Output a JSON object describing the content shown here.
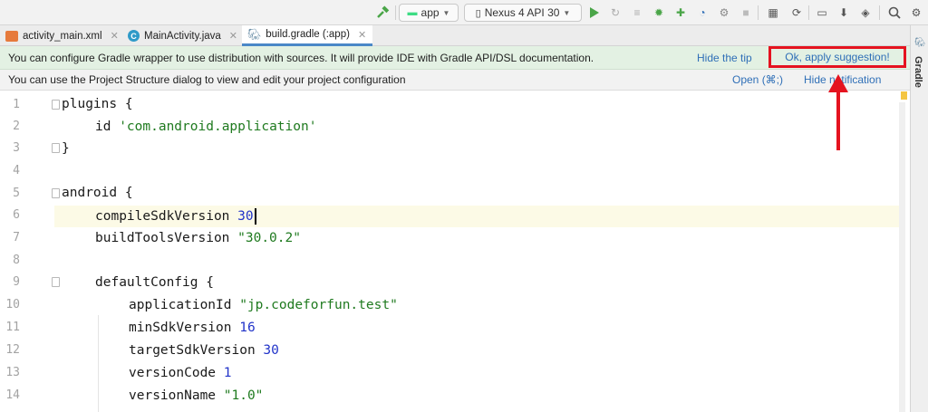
{
  "toolbar": {
    "run_config": "app",
    "device": "Nexus 4 API 30",
    "colors": {
      "run_green": "#4aa548",
      "android_green": "#3ddc84"
    }
  },
  "tabs": [
    {
      "label": "activity_main.xml",
      "icon": "layout-file-icon"
    },
    {
      "label": "MainActivity.java",
      "icon": "java-class-icon"
    },
    {
      "label": "build.gradle (:app)",
      "icon": "gradle-elephant-icon",
      "active": true
    }
  ],
  "side_panel": {
    "label": "Gradle"
  },
  "banner_gradle": {
    "message": "You can configure Gradle wrapper to use distribution with sources. It will provide IDE with Gradle API/DSL documentation.",
    "hide_tip": "Hide the tip",
    "apply": "Ok, apply suggestion!"
  },
  "banner_structure": {
    "message": "You can use the Project Structure dialog to view and edit your project configuration",
    "open": "Open (⌘;)",
    "hide": "Hide notification"
  },
  "editor": {
    "line_numbers": [
      "1",
      "2",
      "3",
      "4",
      "5",
      "6",
      "7",
      "8",
      "9",
      "10",
      "11",
      "12",
      "13",
      "14"
    ],
    "lines": {
      "l1": "plugins {",
      "l2_kw": "id ",
      "l2_str": "'com.android.application'",
      "l3": "}",
      "l5": "android {",
      "l6_kw": "compileSdkVersion ",
      "l6_num": "30",
      "l7_kw": "buildToolsVersion ",
      "l7_str": "\"30.0.2\"",
      "l9": "defaultConfig {",
      "l10_kw": "applicationId ",
      "l10_str": "\"jp.codeforfun.test\"",
      "l11_kw": "minSdkVersion ",
      "l11_num": "16",
      "l12_kw": "targetSdkVersion ",
      "l12_num": "30",
      "l13_kw": "versionCode ",
      "l13_num": "1",
      "l14_kw": "versionName ",
      "l14_str": "\"1.0\""
    }
  },
  "annotation": {
    "color": "#e5131f"
  }
}
